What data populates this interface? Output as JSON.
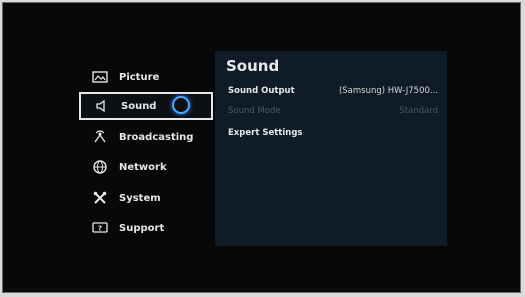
{
  "menu": {
    "items": [
      {
        "label": "Picture",
        "icon": "picture-icon"
      },
      {
        "label": "Sound",
        "icon": "speaker-icon",
        "selected": true
      },
      {
        "label": "Broadcasting",
        "icon": "broadcast-icon"
      },
      {
        "label": "Network",
        "icon": "globe-icon"
      },
      {
        "label": "System",
        "icon": "tools-icon"
      },
      {
        "label": "Support",
        "icon": "support-icon"
      }
    ]
  },
  "panel": {
    "title": "Sound",
    "rows": [
      {
        "label": "Sound Output",
        "value": "(Samsung) HW-J7500..."
      },
      {
        "label": "Sound Mode",
        "value": "Standard",
        "disabled": true
      },
      {
        "label": "Expert Settings",
        "value": ""
      }
    ]
  },
  "colors": {
    "panel_bg": "#0f1b26",
    "focus_ring": "#4aa9ff"
  }
}
